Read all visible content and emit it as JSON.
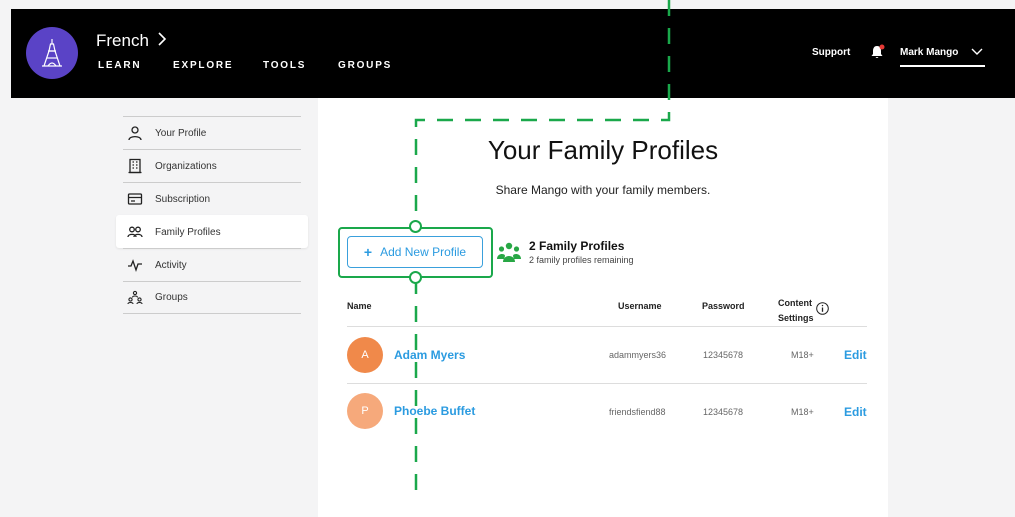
{
  "header": {
    "language": "French",
    "nav": [
      "LEARN",
      "EXPLORE",
      "TOOLS",
      "GROUPS"
    ],
    "support": "Support",
    "user_name": "Mark Mango",
    "logo_icon": "eiffel-tower-icon",
    "notification_dot_color": "#e53935"
  },
  "sidebar": {
    "items": [
      {
        "label": "Your Profile",
        "icon": "person-icon"
      },
      {
        "label": "Organizations",
        "icon": "building-icon"
      },
      {
        "label": "Subscription",
        "icon": "card-icon"
      },
      {
        "label": "Family Profiles",
        "icon": "people-icon",
        "active": true
      },
      {
        "label": "Activity",
        "icon": "activity-icon"
      },
      {
        "label": "Groups",
        "icon": "groups-icon"
      }
    ]
  },
  "main": {
    "title": "Your Family Profiles",
    "subtitle": "Share Mango with your family members.",
    "add_button": "Add New Profile",
    "family_count_title": "2 Family Profiles",
    "family_remaining": "2 family profiles remaining",
    "columns": {
      "name": "Name",
      "username": "Username",
      "password": "Password",
      "content_settings_line1": "Content",
      "content_settings_line2": "Settings"
    },
    "profiles": [
      {
        "initial": "A",
        "name": "Adam Myers",
        "username": "adammyers36",
        "password": "12345678",
        "content": "M18+",
        "edit": "Edit",
        "avatar_color": "#f0894a"
      },
      {
        "initial": "P",
        "name": "Phoebe Buffet",
        "username": "friendsfiend88",
        "password": "12345678",
        "content": "M18+",
        "edit": "Edit",
        "avatar_color": "#f6a97b"
      }
    ]
  },
  "colors": {
    "accent_blue": "#2b9be0",
    "annotation_green": "#1aa84b",
    "brand_purple": "#5a43c6"
  }
}
